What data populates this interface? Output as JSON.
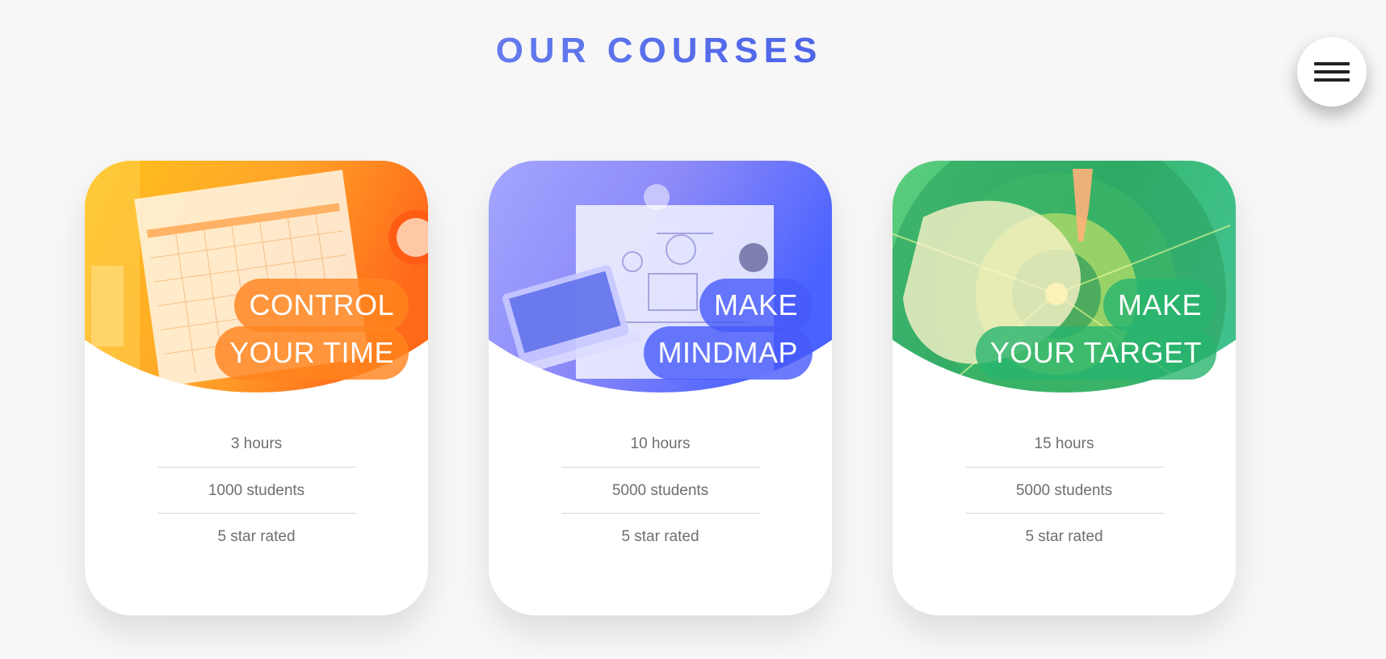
{
  "page": {
    "title": "OUR COURSES"
  },
  "menu": {
    "icon": "hamburger-menu-icon"
  },
  "courses": [
    {
      "title_line1": "CONTROL",
      "title_line2": "YOUR TIME",
      "image": "calendar-clock-photo",
      "accent_color": "#ff8a1e",
      "stats": [
        "3 hours",
        "1000 students",
        "5 star rated"
      ]
    },
    {
      "title_line1": "MAKE",
      "title_line2": "MINDMAP",
      "image": "desk-laptop-mindmap-photo",
      "accent_color": "#4a5cf5",
      "stats": [
        "10 hours",
        "5000 students",
        "5 star rated"
      ]
    },
    {
      "title_line1": "MAKE",
      "title_line2": "YOUR TARGET",
      "image": "dartboard-hand-photo",
      "accent_color": "#2fb472",
      "stats": [
        "15 hours",
        "5000 students",
        "5 star rated"
      ]
    }
  ]
}
